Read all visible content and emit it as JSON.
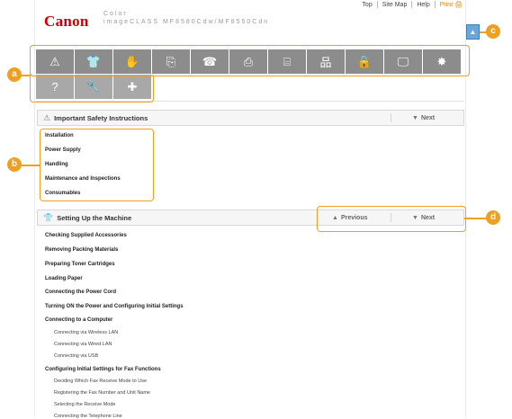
{
  "header": {
    "logo": "Canon",
    "product_line1": "Color",
    "product_line2": "imageCLASS  MF8580Cdw/MF8550Cdn",
    "nav": [
      "Top",
      "Site Map",
      "Help"
    ],
    "print_label": "Print"
  },
  "toolbar": {
    "row1": [
      {
        "icon": "warning-icon",
        "glyph": "⚠"
      },
      {
        "icon": "machine-icon",
        "glyph": "👕"
      },
      {
        "icon": "touch-icon",
        "glyph": "✋"
      },
      {
        "icon": "copy-icon",
        "glyph": "⎘"
      },
      {
        "icon": "fax-icon",
        "glyph": "☎"
      },
      {
        "icon": "print-icon",
        "glyph": "⎙"
      },
      {
        "icon": "scan-icon",
        "glyph": "⌸"
      },
      {
        "icon": "network-icon",
        "glyph": "品"
      },
      {
        "icon": "lock-icon",
        "glyph": "🔒"
      },
      {
        "icon": "remote-ui-icon",
        "glyph": "🖵"
      },
      {
        "icon": "settings-icon",
        "glyph": "✸"
      }
    ],
    "row2": [
      {
        "icon": "help-icon",
        "glyph": "?"
      },
      {
        "icon": "wrench-icon",
        "glyph": "🔧"
      },
      {
        "icon": "plus-icon",
        "glyph": "✚"
      }
    ]
  },
  "callouts": {
    "a": "a",
    "b": "b",
    "c": "c",
    "d": "d"
  },
  "safety": {
    "title": "Important Safety Instructions",
    "next": "Next",
    "items": [
      "Installation",
      "Power Supply",
      "Handling",
      "Maintenance and Inspections",
      "Consumables"
    ]
  },
  "setup": {
    "title": "Setting Up the Machine",
    "previous": "Previous",
    "next": "Next",
    "items": [
      {
        "text": "Checking Supplied Accessories",
        "sub": false
      },
      {
        "text": "Removing Packing Materials",
        "sub": false
      },
      {
        "text": "Preparing Toner Cartridges",
        "sub": false
      },
      {
        "text": "Loading Paper",
        "sub": false
      },
      {
        "text": "Connecting the Power Cord",
        "sub": false
      },
      {
        "text": "Turning ON the Power and Configuring Initial Settings",
        "sub": false
      },
      {
        "text": "Connecting to a Computer",
        "sub": false
      },
      {
        "text": "Connecting via Wireless LAN",
        "sub": true
      },
      {
        "text": "Connecting via Wired LAN",
        "sub": true
      },
      {
        "text": "Connecting via USB",
        "sub": true
      },
      {
        "text": "Configuring Initial Settings for Fax Functions",
        "sub": false
      },
      {
        "text": "Deciding Which Fax Receive Mode to Use",
        "sub": true
      },
      {
        "text": "Registering the Fax Number and Unit Name",
        "sub": true
      },
      {
        "text": "Selecting the Receive Mode",
        "sub": true
      },
      {
        "text": "Connecting the Telephone Line",
        "sub": true
      }
    ]
  },
  "colors": {
    "accent": "#f0a020",
    "brand": "#cc0000",
    "toolbar": "#8c8c8c",
    "pagetop": "#6aa6d8"
  }
}
